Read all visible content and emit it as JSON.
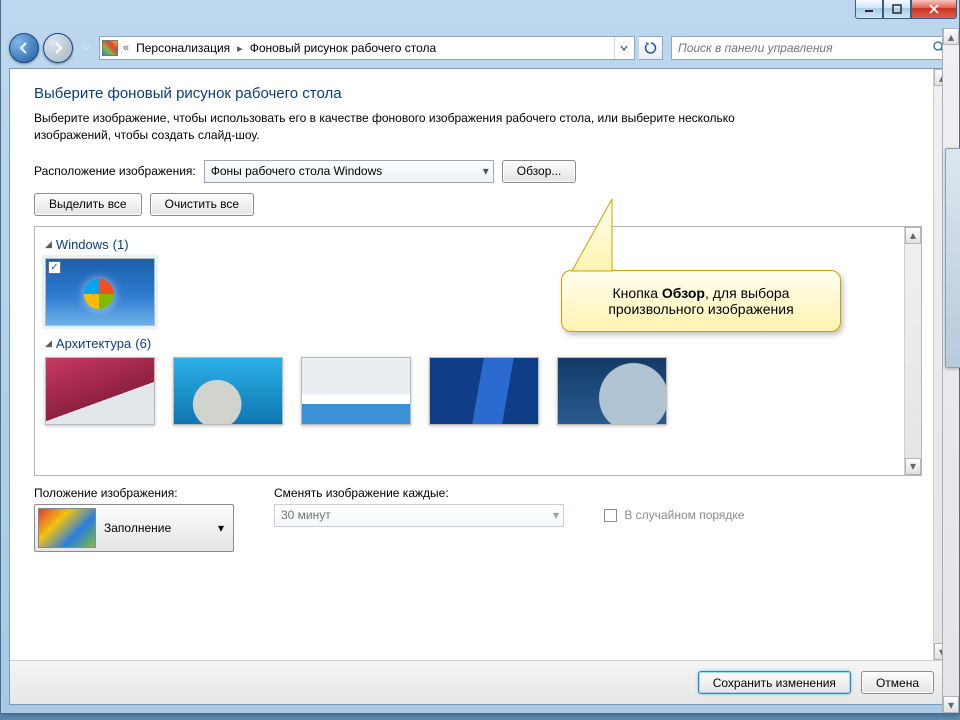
{
  "breadcrumb": {
    "prefix_icon": "control-panel-icon",
    "seg1": "Персонализация",
    "seg2": "Фоновый рисунок рабочего стола"
  },
  "search": {
    "placeholder": "Поиск в панели управления"
  },
  "heading": "Выберите фоновый рисунок рабочего стола",
  "description": "Выберите изображение, чтобы использовать его в качестве фонового изображения рабочего стола, или выберите несколько изображений, чтобы создать слайд-шоу.",
  "location_label": "Расположение изображения:",
  "location_value": "Фоны рабочего стола Windows",
  "browse_btn": "Обзор...",
  "select_all_btn": "Выделить все",
  "clear_all_btn": "Очистить все",
  "groups": [
    {
      "name": "Windows",
      "count": 1
    },
    {
      "name": "Архитектура",
      "count": 6
    }
  ],
  "position_label": "Положение изображения:",
  "position_value": "Заполнение",
  "interval_label": "Сменять изображение каждые:",
  "interval_value": "30 минут",
  "shuffle_label": "В случайном порядке",
  "save_btn": "Сохранить изменения",
  "cancel_btn": "Отмена",
  "callout": {
    "prefix": "Кнопка ",
    "bold": "Обзор",
    "suffix": ", для выбора произвольного изображения"
  }
}
